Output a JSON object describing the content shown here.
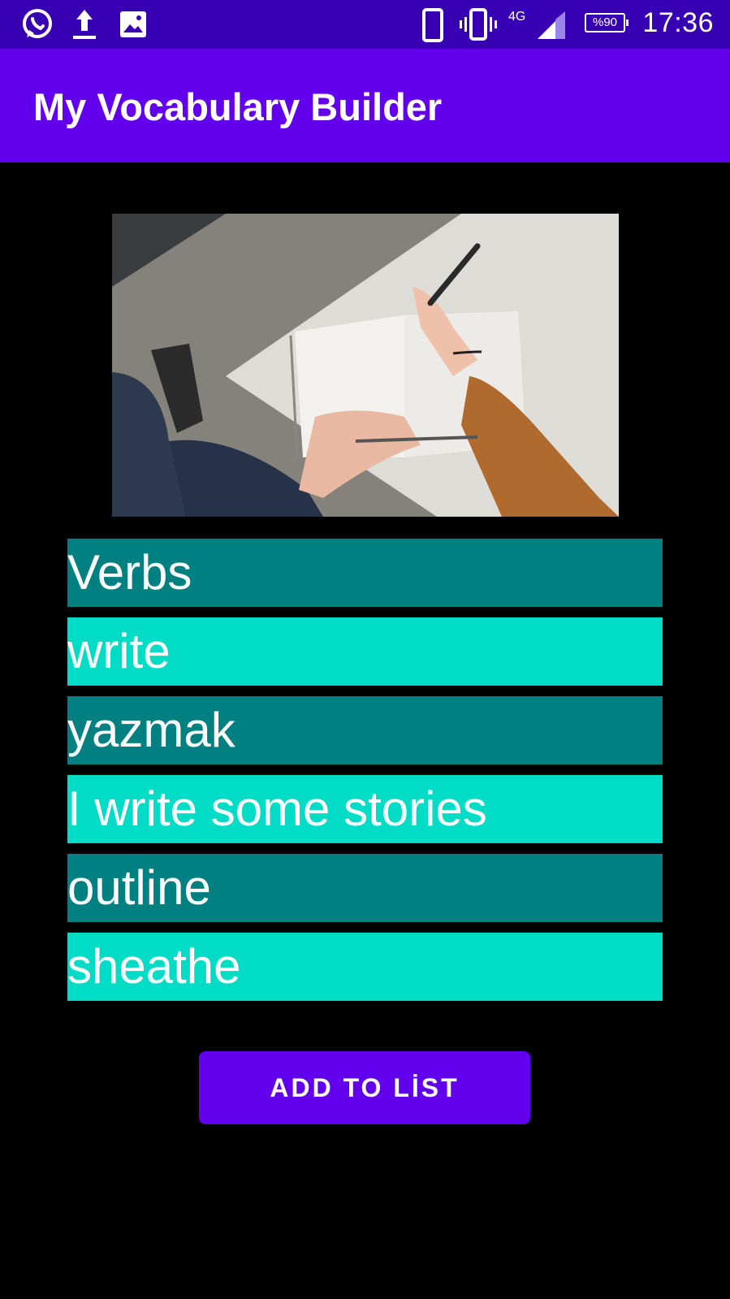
{
  "status_bar": {
    "time": "17:36",
    "battery": "%90",
    "network": "4G",
    "icons": [
      "whatsapp-icon",
      "upload-icon",
      "image-icon",
      "phone-icon",
      "vibrate-icon",
      "signal-icon",
      "battery-icon"
    ]
  },
  "app_bar": {
    "title": "My Vocabulary Builder",
    "color": "#6200ee"
  },
  "list": {
    "items": [
      {
        "text": "Verbs"
      },
      {
        "text": "write"
      },
      {
        "text": "yazmak"
      },
      {
        "text": "I write some stories"
      },
      {
        "text": "outline"
      },
      {
        "text": "sheathe"
      }
    ],
    "colors": {
      "dark": "#008080",
      "light": "#00dcc6"
    }
  },
  "actions": {
    "add_label": "ADD TO LİST"
  }
}
